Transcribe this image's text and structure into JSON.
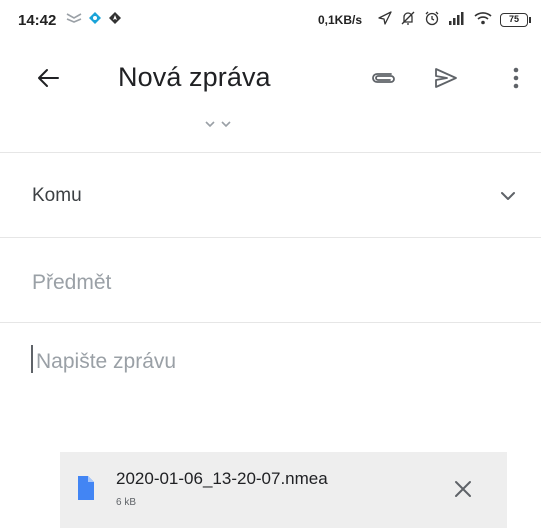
{
  "status_bar": {
    "time": "14:42",
    "network_speed": "0,1KB/s",
    "battery": "75",
    "left_icons": [
      "message-icon",
      "location-icon",
      "navigation-icon"
    ],
    "right_icons": [
      "send-arrow-icon",
      "mute-icon",
      "alarm-icon",
      "signal-icon",
      "wifi-icon"
    ]
  },
  "toolbar": {
    "title": "Nová zpráva",
    "icons": [
      "back-arrow-icon",
      "attachment-icon",
      "send-icon",
      "more-vert-icon"
    ]
  },
  "compose": {
    "to_label": "Komu",
    "subject_placeholder": "Předmět",
    "body_placeholder": "Napište zprávu"
  },
  "attachment": {
    "file_name": "2020-01-06_13-20-07.nmea",
    "file_size": "6 kB"
  },
  "colors": {
    "background": "#ffffff",
    "attachment_bg": "#eeeeee",
    "file_icon": "#4285f4",
    "divider": "#e6e6e6",
    "placeholder": "#9aa0a6"
  }
}
